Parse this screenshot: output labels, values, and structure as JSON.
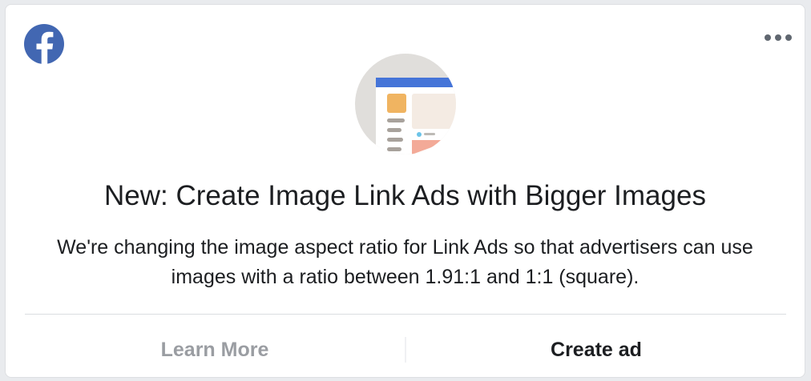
{
  "card": {
    "brand": "facebook",
    "headline": "New: Create Image Link Ads with Bigger Images",
    "body": "We're changing the image aspect ratio for Link Ads so that advertisers can use images with a ratio between 1.91:1 and 1:1 (square).",
    "icons": {
      "logo": "facebook-logo-icon",
      "more": "more-options-icon",
      "illustration": "ad-preview-illustration"
    }
  },
  "footer": {
    "learn_more_label": "Learn More",
    "create_ad_label": "Create ad"
  },
  "colors": {
    "brand_blue": "#4267b2",
    "text_primary": "#1c1e21",
    "text_disabled": "#9a9da2"
  }
}
